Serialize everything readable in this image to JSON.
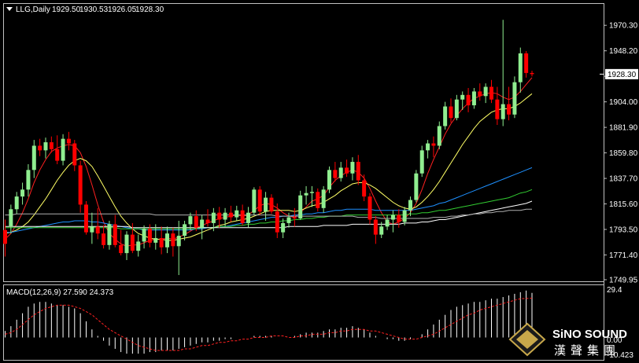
{
  "header": {
    "title": "LLG,Daily",
    "open": "1929.50",
    "high": "1930.53",
    "low": "1926.05",
    "close": "1928.30"
  },
  "price_axis": {
    "ticks": [
      "1970.30",
      "1948.20",
      "1926.10",
      "1904.00",
      "1881.90",
      "1859.80",
      "1837.70",
      "1815.60",
      "1793.50",
      "1771.40",
      "1749.95"
    ],
    "current_price_label": "1928.30"
  },
  "macd_panel": {
    "label": "MACD(12,26,9) 27.590 24.373",
    "ticks": [
      "29.4",
      "0.00",
      "-10.423"
    ]
  },
  "watermark": {
    "brand": "SiNO SOUND",
    "chinese": "漢聲集團"
  },
  "colors": {
    "background": "#000000",
    "up_candle": "#90ee90",
    "down_candle": "#ff0000",
    "ma_fast": "#ff2020",
    "ma_slow": "#ffff66",
    "ma_blue": "#1e90ff",
    "ma_green": "#32cd32",
    "ma_white": "#ffffff",
    "ma_gray": "#b0b0b0",
    "macd_bar": "#ffffff",
    "macd_signal": "#ff2020"
  },
  "chart_data": {
    "type": "candlestick",
    "timeframe": "Daily",
    "price_range": [
      1749.95,
      1985.0
    ],
    "candles": [
      [
        1793,
        1802,
        1770,
        1781
      ],
      [
        1796,
        1815,
        1790,
        1811
      ],
      [
        1811,
        1826,
        1807,
        1822
      ],
      [
        1822,
        1834,
        1815,
        1828
      ],
      [
        1828,
        1850,
        1822,
        1845
      ],
      [
        1845,
        1871,
        1838,
        1866
      ],
      [
        1866,
        1872,
        1857,
        1862
      ],
      [
        1862,
        1873,
        1855,
        1869
      ],
      [
        1869,
        1874,
        1860,
        1863
      ],
      [
        1863,
        1875,
        1850,
        1853
      ],
      [
        1853,
        1876,
        1849,
        1872
      ],
      [
        1872,
        1878,
        1862,
        1868
      ],
      [
        1868,
        1871,
        1844,
        1849
      ],
      [
        1849,
        1853,
        1808,
        1815
      ],
      [
        1815,
        1818,
        1789,
        1791
      ],
      [
        1791,
        1808,
        1781,
        1796
      ],
      [
        1796,
        1812,
        1785,
        1790
      ],
      [
        1790,
        1797,
        1777,
        1780
      ],
      [
        1780,
        1801,
        1776,
        1798
      ],
      [
        1798,
        1806,
        1778,
        1780
      ],
      [
        1780,
        1793,
        1771,
        1773
      ],
      [
        1773,
        1792,
        1767,
        1789
      ],
      [
        1789,
        1799,
        1773,
        1775
      ],
      [
        1775,
        1789,
        1770,
        1783
      ],
      [
        1783,
        1797,
        1777,
        1794
      ],
      [
        1794,
        1798,
        1778,
        1782
      ],
      [
        1782,
        1798,
        1776,
        1786
      ],
      [
        1786,
        1796,
        1772,
        1778
      ],
      [
        1778,
        1796,
        1773,
        1790
      ],
      [
        1790,
        1795,
        1770,
        1779
      ],
      [
        1779,
        1801,
        1754,
        1788
      ],
      [
        1788,
        1801,
        1784,
        1798
      ],
      [
        1798,
        1808,
        1793,
        1805
      ],
      [
        1805,
        1810,
        1792,
        1795
      ],
      [
        1795,
        1806,
        1785,
        1802
      ],
      [
        1802,
        1811,
        1796,
        1799
      ],
      [
        1799,
        1812,
        1792,
        1808
      ],
      [
        1808,
        1813,
        1795,
        1802
      ],
      [
        1802,
        1812,
        1796,
        1808
      ],
      [
        1808,
        1814,
        1800,
        1804
      ],
      [
        1804,
        1814,
        1801,
        1810
      ],
      [
        1810,
        1815,
        1797,
        1799
      ],
      [
        1799,
        1813,
        1795,
        1808
      ],
      [
        1808,
        1830,
        1806,
        1828
      ],
      [
        1828,
        1831,
        1806,
        1809
      ],
      [
        1809,
        1826,
        1801,
        1821
      ],
      [
        1821,
        1824,
        1807,
        1809
      ],
      [
        1809,
        1816,
        1786,
        1791
      ],
      [
        1791,
        1803,
        1786,
        1799
      ],
      [
        1799,
        1808,
        1795,
        1804
      ],
      [
        1804,
        1812,
        1796,
        1803
      ],
      [
        1803,
        1827,
        1802,
        1823
      ],
      [
        1823,
        1831,
        1815,
        1825
      ],
      [
        1825,
        1831,
        1813,
        1826
      ],
      [
        1826,
        1829,
        1809,
        1812
      ],
      [
        1812,
        1831,
        1808,
        1828
      ],
      [
        1828,
        1848,
        1825,
        1845
      ],
      [
        1845,
        1852,
        1835,
        1838
      ],
      [
        1838,
        1852,
        1835,
        1847
      ],
      [
        1847,
        1854,
        1839,
        1842
      ],
      [
        1842,
        1856,
        1836,
        1852
      ],
      [
        1852,
        1858,
        1832,
        1836
      ],
      [
        1836,
        1841,
        1818,
        1822
      ],
      [
        1822,
        1825,
        1798,
        1802
      ],
      [
        1802,
        1805,
        1781,
        1789
      ],
      [
        1789,
        1800,
        1786,
        1796
      ],
      [
        1796,
        1806,
        1793,
        1802
      ],
      [
        1802,
        1810,
        1791,
        1806
      ],
      [
        1806,
        1811,
        1795,
        1800
      ],
      [
        1800,
        1813,
        1797,
        1810
      ],
      [
        1810,
        1822,
        1805,
        1819
      ],
      [
        1819,
        1845,
        1817,
        1842
      ],
      [
        1842,
        1866,
        1839,
        1862
      ],
      [
        1862,
        1871,
        1855,
        1868
      ],
      [
        1868,
        1874,
        1856,
        1866
      ],
      [
        1866,
        1887,
        1863,
        1883
      ],
      [
        1883,
        1904,
        1880,
        1900
      ],
      [
        1900,
        1907,
        1886,
        1890
      ],
      [
        1890,
        1910,
        1888,
        1906
      ],
      [
        1906,
        1913,
        1897,
        1910
      ],
      [
        1910,
        1916,
        1895,
        1901
      ],
      [
        1901,
        1916,
        1898,
        1913
      ],
      [
        1913,
        1920,
        1905,
        1909
      ],
      [
        1909,
        1920,
        1903,
        1917
      ],
      [
        1917,
        1923,
        1903,
        1906
      ],
      [
        1906,
        1917,
        1884,
        1889
      ],
      [
        1889,
        1975,
        1883,
        1902
      ],
      [
        1902,
        1917,
        1888,
        1893
      ],
      [
        1893,
        1926,
        1890,
        1921
      ],
      [
        1921,
        1951,
        1912,
        1946
      ],
      [
        1946,
        1948,
        1925,
        1929
      ],
      [
        1929,
        1931,
        1926,
        1928
      ]
    ],
    "moving_averages": [
      {
        "color": "#ff2020",
        "values": [
          1785,
          1790,
          1798,
          1808,
          1820,
          1834,
          1845,
          1854,
          1861,
          1864,
          1866,
          1867,
          1866,
          1860,
          1848,
          1832,
          1815,
          1800,
          1790,
          1785,
          1781,
          1779,
          1780,
          1780,
          1782,
          1784,
          1785,
          1785,
          1786,
          1785,
          1787,
          1789,
          1792,
          1795,
          1797,
          1799,
          1801,
          1803,
          1804,
          1805,
          1806,
          1805,
          1806,
          1810,
          1814,
          1816,
          1815,
          1812,
          1808,
          1805,
          1804,
          1808,
          1813,
          1818,
          1820,
          1823,
          1830,
          1836,
          1840,
          1843,
          1845,
          1843,
          1838,
          1829,
          1818,
          1808,
          1800,
          1798,
          1800,
          1803,
          1808,
          1816,
          1828,
          1842,
          1854,
          1865,
          1876,
          1885,
          1892,
          1898,
          1903,
          1907,
          1909,
          1911,
          1912,
          1911,
          1908,
          1906,
          1908,
          1913,
          1919,
          1925
        ]
      },
      {
        "color": "#ffff66",
        "values": [
          1790,
          1791,
          1793,
          1796,
          1800,
          1806,
          1813,
          1820,
          1828,
          1836,
          1843,
          1849,
          1853,
          1855,
          1853,
          1848,
          1840,
          1831,
          1822,
          1813,
          1805,
          1799,
          1794,
          1790,
          1788,
          1786,
          1785,
          1785,
          1784,
          1784,
          1785,
          1786,
          1787,
          1789,
          1791,
          1793,
          1795,
          1797,
          1798,
          1800,
          1801,
          1802,
          1803,
          1805,
          1807,
          1809,
          1810,
          1810,
          1810,
          1810,
          1809,
          1810,
          1812,
          1814,
          1815,
          1817,
          1820,
          1823,
          1827,
          1830,
          1833,
          1834,
          1834,
          1832,
          1829,
          1825,
          1821,
          1817,
          1814,
          1812,
          1811,
          1813,
          1817,
          1822,
          1828,
          1835,
          1843,
          1851,
          1859,
          1867,
          1874,
          1881,
          1887,
          1891,
          1895,
          1897,
          1898,
          1898,
          1900,
          1903,
          1907,
          1911
        ]
      },
      {
        "color": "#1e90ff",
        "values": [
          1791,
          1791,
          1792,
          1793,
          1794,
          1795,
          1796,
          1797,
          1798,
          1799,
          1800,
          1800,
          1801,
          1801,
          1801,
          1800,
          1800,
          1799,
          1798,
          1797,
          1796,
          1795,
          1794,
          1794,
          1793,
          1793,
          1793,
          1793,
          1793,
          1793,
          1793,
          1793,
          1793,
          1794,
          1794,
          1795,
          1795,
          1796,
          1796,
          1797,
          1798,
          1799,
          1800,
          1801,
          1802,
          1803,
          1804,
          1804,
          1805,
          1805,
          1806,
          1806,
          1807,
          1807,
          1808,
          1808,
          1809,
          1810,
          1810,
          1811,
          1811,
          1811,
          1811,
          1811,
          1810,
          1810,
          1810,
          1810,
          1810,
          1810,
          1810,
          1811,
          1812,
          1813,
          1814,
          1816,
          1817,
          1819,
          1821,
          1823,
          1825,
          1827,
          1829,
          1831,
          1833,
          1835,
          1837,
          1839,
          1841,
          1843,
          1845,
          1847
        ]
      },
      {
        "color": "#32cd32",
        "values": [
          1795,
          1795,
          1795,
          1795,
          1795,
          1795,
          1795,
          1795,
          1795,
          1795,
          1795,
          1795,
          1795,
          1795,
          1795,
          1795,
          1795,
          1795,
          1795,
          1795,
          1794,
          1794,
          1794,
          1794,
          1794,
          1794,
          1794,
          1794,
          1794,
          1794,
          1794,
          1794,
          1794,
          1794,
          1795,
          1795,
          1795,
          1796,
          1796,
          1796,
          1797,
          1797,
          1798,
          1798,
          1799,
          1799,
          1800,
          1800,
          1801,
          1801,
          1802,
          1802,
          1803,
          1803,
          1804,
          1804,
          1805,
          1805,
          1805,
          1806,
          1806,
          1806,
          1806,
          1806,
          1806,
          1806,
          1806,
          1806,
          1806,
          1806,
          1807,
          1807,
          1808,
          1808,
          1809,
          1810,
          1810,
          1811,
          1812,
          1813,
          1814,
          1815,
          1816,
          1817,
          1818,
          1819,
          1820,
          1821,
          1823,
          1825,
          1826,
          1828
        ]
      },
      {
        "color": "#ffffff",
        "values": [
          1796,
          1796,
          1796,
          1796,
          1796,
          1796,
          1796,
          1796,
          1796,
          1796,
          1796,
          1796,
          1796,
          1796,
          1796,
          1796,
          1796,
          1796,
          1796,
          1796,
          1796,
          1796,
          1795,
          1795,
          1795,
          1795,
          1795,
          1795,
          1795,
          1795,
          1795,
          1795,
          1795,
          1795,
          1795,
          1795,
          1795,
          1795,
          1795,
          1795,
          1795,
          1795,
          1795,
          1795,
          1795,
          1795,
          1795,
          1795,
          1795,
          1796,
          1796,
          1796,
          1796,
          1796,
          1796,
          1797,
          1797,
          1797,
          1797,
          1797,
          1798,
          1798,
          1798,
          1798,
          1798,
          1798,
          1798,
          1798,
          1798,
          1799,
          1799,
          1799,
          1800,
          1800,
          1801,
          1802,
          1802,
          1803,
          1804,
          1805,
          1806,
          1807,
          1808,
          1809,
          1810,
          1811,
          1812,
          1813,
          1814,
          1815,
          1816,
          1818
        ]
      },
      {
        "color": "#b0b0b0",
        "values": [
          1806,
          1806,
          1807,
          1807,
          1807,
          1807,
          1807,
          1807,
          1807,
          1807,
          1807,
          1807,
          1807,
          1807,
          1807,
          1807,
          1807,
          1807,
          1807,
          1807,
          1807,
          1807,
          1807,
          1807,
          1807,
          1807,
          1806,
          1806,
          1806,
          1806,
          1806,
          1806,
          1806,
          1806,
          1806,
          1806,
          1806,
          1806,
          1806,
          1806,
          1806,
          1806,
          1806,
          1806,
          1806,
          1806,
          1806,
          1805,
          1805,
          1805,
          1805,
          1805,
          1805,
          1805,
          1805,
          1805,
          1805,
          1805,
          1805,
          1805,
          1805,
          1804,
          1804,
          1804,
          1804,
          1803,
          1803,
          1803,
          1803,
          1803,
          1803,
          1803,
          1803,
          1803,
          1804,
          1804,
          1804,
          1805,
          1805,
          1806,
          1806,
          1807,
          1807,
          1808,
          1808,
          1809,
          1809,
          1810,
          1810,
          1810,
          1811,
          1811
        ]
      }
    ],
    "macd": {
      "range": [
        -10.423,
        29.4
      ],
      "histogram": [
        4,
        7,
        11,
        15,
        19,
        21,
        22,
        22,
        21,
        20,
        20,
        19,
        18,
        15,
        10,
        5,
        1,
        -2,
        -5,
        -7,
        -9,
        -10,
        -10,
        -10,
        -10,
        -9,
        -9,
        -8,
        -8,
        -8,
        -7,
        -6,
        -5,
        -4,
        -3,
        -3,
        -2,
        -2,
        -1,
        -1,
        0,
        0,
        0,
        1,
        1,
        1,
        1,
        0,
        0,
        0,
        1,
        2,
        3,
        3,
        3,
        4,
        5,
        5,
        6,
        6,
        7,
        6,
        5,
        3,
        1,
        0,
        -1,
        -1,
        -2,
        -2,
        -1,
        0,
        2,
        5,
        8,
        11,
        14,
        17,
        19,
        20,
        21,
        22,
        22,
        23,
        24,
        24,
        25,
        26,
        27,
        28,
        29,
        27.6
      ],
      "signal": [
        2,
        3,
        5,
        8,
        11,
        14,
        16,
        18,
        19,
        20,
        20,
        20,
        19,
        18,
        16,
        14,
        11,
        8,
        5,
        3,
        1,
        -1,
        -3,
        -5,
        -6,
        -7,
        -8,
        -8,
        -8,
        -8,
        -8,
        -7,
        -7,
        -6,
        -5,
        -5,
        -4,
        -3,
        -3,
        -2,
        -2,
        -1,
        -1,
        0,
        0,
        0,
        1,
        1,
        1,
        0,
        0,
        1,
        1,
        2,
        2,
        2,
        3,
        3,
        4,
        4,
        5,
        5,
        5,
        4,
        4,
        3,
        2,
        1,
        0,
        -1,
        -1,
        -1,
        0,
        1,
        2,
        4,
        6,
        8,
        10,
        12,
        14,
        15,
        17,
        18,
        19,
        20,
        21,
        22,
        23,
        24,
        24.1,
        24.373
      ]
    }
  }
}
